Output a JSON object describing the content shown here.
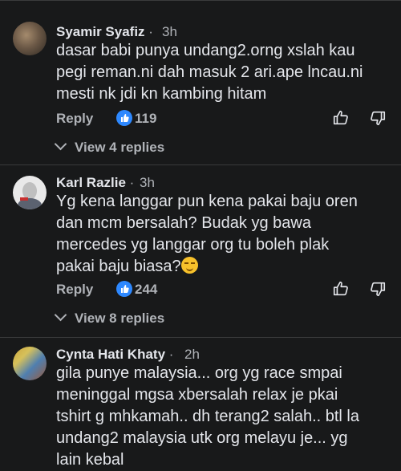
{
  "comments": [
    {
      "author": "Syamir Syafiz",
      "time": "3h",
      "lines": [
        "dasar babi punya undang2.orng xslah kau",
        "pegi reman.ni dah masuk 2 ari.ape lncau.ni",
        "mesti nk jdi kn kambing hitam"
      ],
      "reply_label": "Reply",
      "likes": "119",
      "view_replies": "View 4 replies"
    },
    {
      "author": "Karl Razlie",
      "time": "3h",
      "lines": [
        "Yg kena langgar pun kena pakai baju oren",
        "dan mcm bersalah? Budak yg bawa",
        "mercedes yg langgar org tu boleh plak",
        "pakai baju biasa?"
      ],
      "reply_label": "Reply",
      "likes": "244",
      "view_replies": "View 8 replies"
    },
    {
      "author": "Cynta Hati Khaty",
      "time": "2h",
      "lines": [
        "gila punye malaysia... org yg race smpai",
        "meninggal mgsa xbersalah relax je pkai",
        "tshirt g mhkamah.. dh terang2 salah.. btl la",
        "undang2 malaysia utk org melayu je... yg",
        "lain kebal"
      ]
    }
  ],
  "colors": {
    "background": "#18191a",
    "text": "#e4e6eb",
    "muted": "#b0b3b8",
    "like": "#2d88ff"
  },
  "icons": [
    "thumbs-up-icon",
    "thumbs-down-icon",
    "chevron-down-icon",
    "like-badge-icon"
  ]
}
